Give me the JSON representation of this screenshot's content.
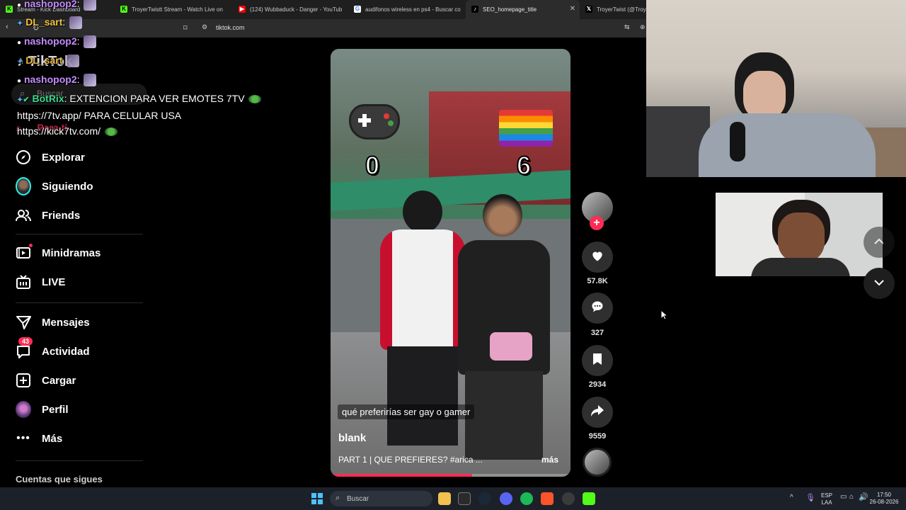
{
  "browser": {
    "tabs": [
      {
        "label": "Stream - Kick Dashboard",
        "icon": "kick-icon",
        "icon_color": "#53fc18"
      },
      {
        "label": "TroyerTwistt Stream - Watch Live on",
        "icon": "kick-icon",
        "icon_color": "#53fc18"
      },
      {
        "label": "(124) Wubbaduck - Danger - YouTub",
        "icon": "youtube-icon",
        "icon_color": "#ff0000"
      },
      {
        "label": "audifonos wireless en ps4 - Buscar co",
        "icon": "google-icon",
        "icon_color": "#ffffff"
      },
      {
        "label": "SEO_homepage_title",
        "icon": "tiktok-icon",
        "icon_color": "#000000"
      },
      {
        "label": "TroyerTwist (@Troy",
        "icon": "x-icon",
        "icon_color": "#000000"
      }
    ],
    "url": "tiktok.com"
  },
  "sidebar": {
    "items": [
      {
        "label": "Explorar",
        "icon": "compass-icon"
      },
      {
        "label": "Siguiendo",
        "icon": "avatar-icon"
      },
      {
        "label": "Friends",
        "icon": "friends-icon"
      },
      {
        "label": "Minidramas",
        "icon": "minidramas-icon"
      },
      {
        "label": "LIVE",
        "icon": "live-tv-icon"
      },
      {
        "label": "Mensajes",
        "icon": "send-icon"
      },
      {
        "label": "Actividad",
        "icon": "activity-icon",
        "badge": "43"
      },
      {
        "label": "Cargar",
        "icon": "upload-icon"
      },
      {
        "label": "Perfil",
        "icon": "profile-avatar-icon"
      },
      {
        "label": "Más",
        "icon": "more-icon"
      }
    ],
    "following_title": "Cuentas que sigues",
    "search_label": "Buscar",
    "foryou_label": "Para ti"
  },
  "chat": {
    "messages": [
      {
        "user": "nashopop2",
        "text": ":"
      },
      {
        "user": "DL_sart",
        "text": ":"
      },
      {
        "user": "nashopop2",
        "text": ":"
      },
      {
        "user": "DL_sart",
        "text": ""
      },
      {
        "user": "nashopop2",
        "text": ":"
      },
      {
        "user": "BotRix",
        "text": ": EXTENCION PARA VER EMOTES 7TV"
      },
      {
        "user": "",
        "text": "https://7tv.app/ PARA CELULAR USA"
      },
      {
        "user": "",
        "text": "https://kick7tv.com/"
      }
    ]
  },
  "video": {
    "left_score": "0",
    "right_score": "6",
    "caption": "qué preferirías ser gay o gamer",
    "author": "blank",
    "description": "PART 1 | QUE PREFIERES? #arica ...",
    "more_label": "más",
    "progress": 0.59
  },
  "actions": {
    "likes": "57.8K",
    "comments": "327",
    "saves": "2934",
    "shares": "9559"
  },
  "taskbar": {
    "search_placeholder": "Buscar",
    "lang_top": "ESP",
    "lang_bottom": "LAA",
    "time": "17:50",
    "date": "26-08-2026"
  }
}
